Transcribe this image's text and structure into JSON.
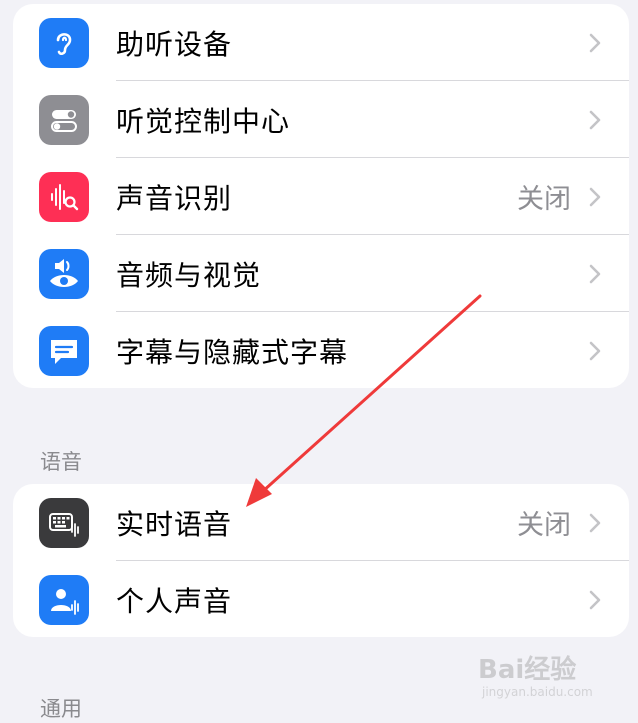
{
  "group1": {
    "items": [
      {
        "label": "助听设备",
        "value": "",
        "icon": "ear-icon",
        "color": "#1f7cf6"
      },
      {
        "label": "听觉控制中心",
        "value": "",
        "icon": "toggles-icon",
        "color": "#8e8e93"
      },
      {
        "label": "声音识别",
        "value": "关闭",
        "icon": "sound-recognition-icon",
        "color": "#fe2f55"
      },
      {
        "label": "音频与视觉",
        "value": "",
        "icon": "speaker-eye-icon",
        "color": "#1f7cf6"
      },
      {
        "label": "字幕与隐藏式字幕",
        "value": "",
        "icon": "captions-icon",
        "color": "#1f7cf6"
      }
    ]
  },
  "speech_section": {
    "header": "语音",
    "items": [
      {
        "label": "实时语音",
        "value": "关闭",
        "icon": "keyboard-waveform-icon",
        "color": "#3a3a3c"
      },
      {
        "label": "个人声音",
        "value": "",
        "icon": "person-waveform-icon",
        "color": "#1f7cf6"
      }
    ]
  },
  "general_section": {
    "header": "通用"
  },
  "annotation": {
    "color": "#ef3a3a"
  },
  "watermark": {
    "brand": "Bai经验",
    "url": "jingyan.baidu.com"
  }
}
